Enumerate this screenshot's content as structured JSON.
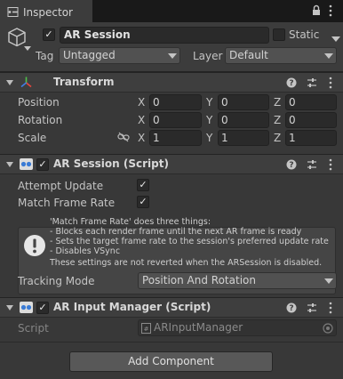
{
  "window": {
    "tab_title": "Inspector"
  },
  "header": {
    "object_name": "AR Session",
    "active": true,
    "static_label": "Static",
    "static_checked": false,
    "tag_label": "Tag",
    "tag_value": "Untagged",
    "layer_label": "Layer",
    "layer_value": "Default"
  },
  "transform": {
    "title": "Transform",
    "rows": [
      {
        "label": "Position",
        "x": "0",
        "y": "0",
        "z": "0"
      },
      {
        "label": "Rotation",
        "x": "0",
        "y": "0",
        "z": "0"
      },
      {
        "label": "Scale",
        "x": "1",
        "y": "1",
        "z": "1"
      }
    ],
    "axis_labels": {
      "x": "X",
      "y": "Y",
      "z": "Z"
    }
  },
  "ar_session": {
    "title": "AR Session (Script)",
    "enabled": true,
    "attempt_update_label": "Attempt Update",
    "attempt_update": true,
    "match_frame_rate_label": "Match Frame Rate",
    "match_frame_rate": true,
    "help_lines": [
      "'Match Frame Rate' does three things:",
      "- Blocks each render frame until the next AR frame is ready",
      "- Sets the target frame rate to the session's preferred update rate",
      "- Disables VSync",
      "These settings are not reverted when the ARSession is disabled."
    ],
    "tracking_mode_label": "Tracking Mode",
    "tracking_mode_value": "Position And Rotation"
  },
  "ar_input_manager": {
    "title": "AR Input Manager (Script)",
    "enabled": true,
    "script_label": "Script",
    "script_value": "ARInputManager"
  },
  "footer": {
    "add_component_label": "Add Component"
  },
  "colors": {
    "background": "#383838",
    "tab_bar": "#191919",
    "field": "#2a2a2a",
    "transform_red": "#e8463d",
    "transform_green": "#4fc24a",
    "transform_blue": "#3f7fe8"
  }
}
